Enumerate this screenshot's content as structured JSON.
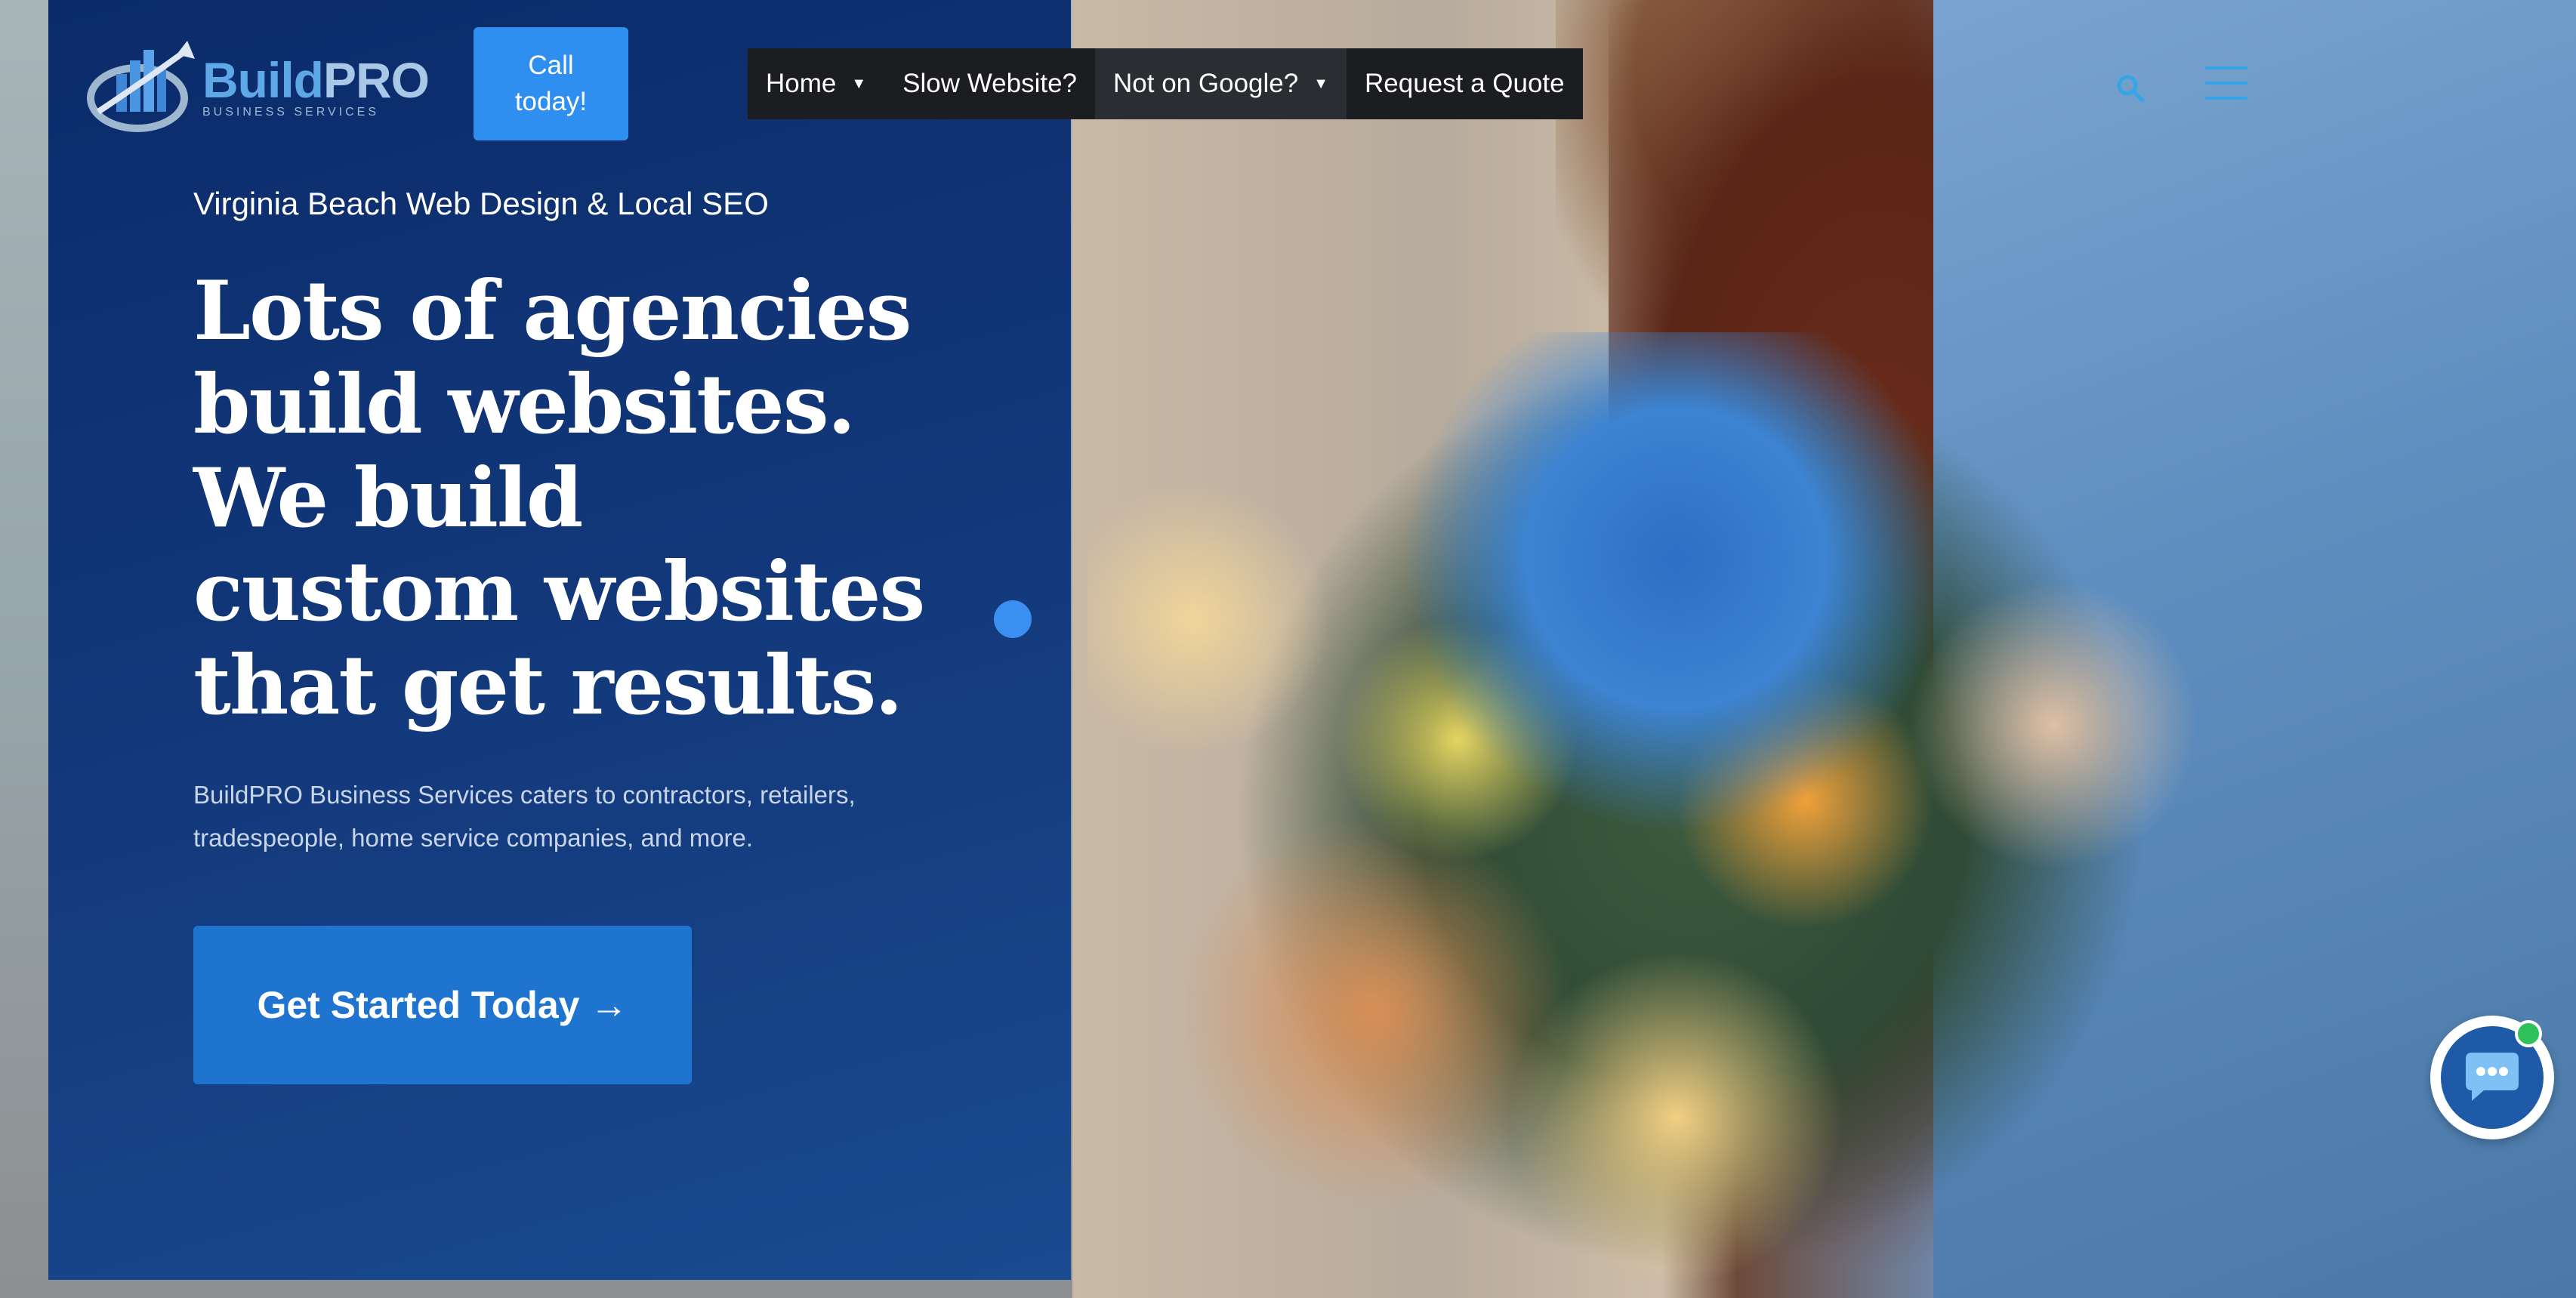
{
  "header": {
    "logo": {
      "brand_main": "Build",
      "brand_accent": "PRO",
      "tagline": "BUSINESS SERVICES"
    },
    "call_button": {
      "line1": "Call",
      "line2": "today!"
    },
    "nav": [
      {
        "label": "Home",
        "has_dropdown": true
      },
      {
        "label": "Slow Website?",
        "has_dropdown": false
      },
      {
        "label": "Not on Google?",
        "has_dropdown": true
      },
      {
        "label": "Request a Quote",
        "has_dropdown": false
      }
    ],
    "icons": {
      "search": "search-icon",
      "menu": "hamburger-menu-icon"
    }
  },
  "hero": {
    "eyebrow": "Virginia Beach Web Design & Local SEO",
    "headline": [
      "Lots of agencies",
      "build websites.",
      "We build",
      "custom websites",
      "that get results."
    ],
    "subtext": "BuildPRO Business Services caters to contractors, retailers, tradespeople, home service companies, and more.",
    "cta": {
      "label": "Get Started Today",
      "arrow": "→"
    }
  },
  "chat": {
    "icon": "chat-support-icon",
    "status": "online"
  },
  "colors": {
    "panel": "#0b2b6a",
    "accent": "#2e8ff0",
    "cta": "#1f74d0",
    "nav_bg": "#1b1d20",
    "icon": "#36a5e8",
    "online": "#2fc25b"
  }
}
